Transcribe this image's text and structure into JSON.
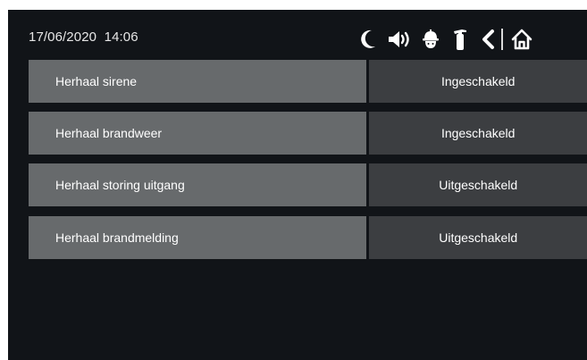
{
  "status_bar": {
    "date": "17/06/2020",
    "time": "14:06",
    "icons": [
      "moon-icon",
      "speaker-icon",
      "fire-helmet-icon",
      "fire-extinguisher-icon",
      "back-icon",
      "home-icon"
    ]
  },
  "settings": [
    {
      "label": "Herhaal sirene",
      "value": "Ingeschakeld"
    },
    {
      "label": "Herhaal brandweer",
      "value": "Ingeschakeld"
    },
    {
      "label": "Herhaal storing uitgang",
      "value": "Uitgeschakeld"
    },
    {
      "label": "Herhaal brandmelding",
      "value": "Uitgeschakeld"
    }
  ],
  "colors": {
    "background": "#111418",
    "label_bg": "#676a6c",
    "value_bg": "#3c3e41",
    "text": "#ffffff"
  }
}
